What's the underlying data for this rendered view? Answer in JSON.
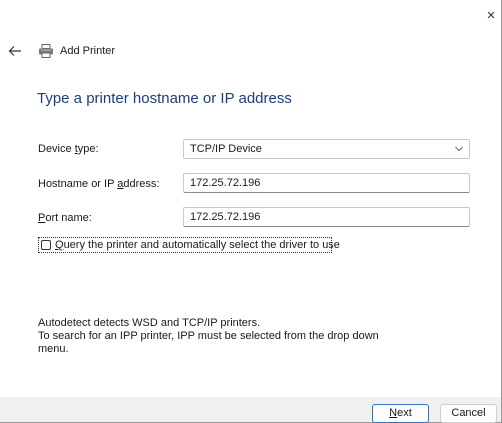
{
  "window": {
    "title": "Add Printer",
    "close_glyph": "×",
    "back_icon": "back-arrow-icon",
    "printer_icon": "printer-icon"
  },
  "page_title": "Type a printer hostname or IP address",
  "form": {
    "device_type": {
      "label_pre": "Device ",
      "label_access": "t",
      "label_post": "ype:",
      "value": "TCP/IP Device"
    },
    "hostname": {
      "label_pre": "Hostname or IP ",
      "label_access": "a",
      "label_post": "ddress:",
      "value": "172.25.72.196"
    },
    "port_name": {
      "label_pre": "",
      "label_access": "P",
      "label_post": "ort name:",
      "value": "172.25.72.196"
    },
    "query_checkbox": {
      "label_access": "Q",
      "label_post": "uery the printer and automatically select the driver to use",
      "checked": false
    }
  },
  "info": {
    "line1": "Autodetect detects WSD and TCP/IP printers.",
    "line2": "To search for an IPP printer, IPP must be selected from the drop down",
    "line3": "menu."
  },
  "buttons": {
    "next_access": "N",
    "next_post": "ext",
    "cancel": "Cancel"
  },
  "colors": {
    "title_blue": "#1d3e7a",
    "footer_bg": "#f0f0f0",
    "default_button_border": "#3b6fc4"
  }
}
